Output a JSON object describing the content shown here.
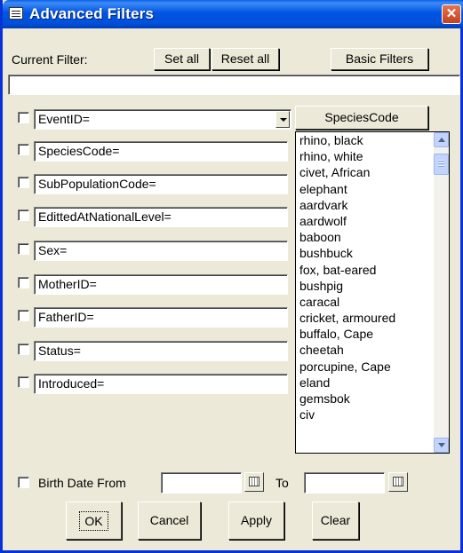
{
  "window": {
    "title": "Advanced Filters",
    "close_glyph": "✕"
  },
  "toolbar": {
    "current_filter_label": "Current Filter:",
    "set_all": "Set all",
    "reset_all": "Reset all",
    "basic_filters": "Basic Filters",
    "current_filter_value": ""
  },
  "fields": [
    {
      "label": "EventID=",
      "checked": false,
      "has_dropdown": true
    },
    {
      "label": "SpeciesCode=",
      "checked": false
    },
    {
      "label": "SubPopulationCode=",
      "checked": false
    },
    {
      "label": "EdittedAtNationalLevel=",
      "checked": false
    },
    {
      "label": "Sex=",
      "checked": false
    },
    {
      "label": "MotherID=",
      "checked": false
    },
    {
      "label": "FatherID=",
      "checked": false
    },
    {
      "label": "Status=",
      "checked": false
    },
    {
      "label": "Introduced=",
      "checked": false
    }
  ],
  "species": {
    "button": "SpeciesCode",
    "items": [
      "rhino, black",
      "rhino, white",
      "civet, African",
      "elephant",
      "aardvark",
      "aardwolf",
      "baboon",
      "bushbuck",
      "fox, bat-eared",
      "bushpig",
      "caracal",
      "cricket, armoured",
      "buffalo, Cape",
      "cheetah",
      "porcupine, Cape",
      "eland",
      "gemsbok",
      "civ"
    ]
  },
  "birth": {
    "label": "Birth Date From",
    "to_label": "To",
    "from_value": "",
    "to_value": ""
  },
  "buttons": {
    "ok": "OK",
    "cancel": "Cancel",
    "apply": "Apply",
    "clear": "Clear"
  },
  "colors": {
    "titlebar": "#0054e3",
    "face": "#ece9d8",
    "close": "#d9512b"
  }
}
